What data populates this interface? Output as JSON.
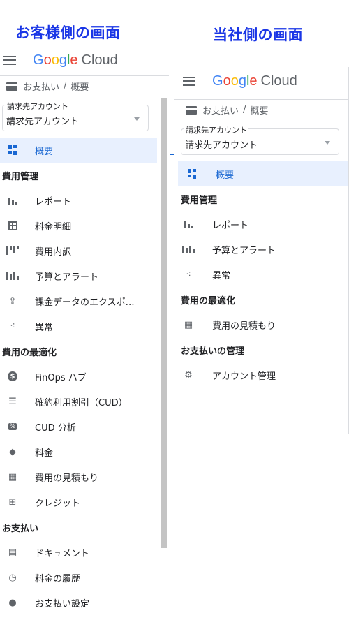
{
  "captions": {
    "left": "お客様側の画面",
    "right": "当社側の画面"
  },
  "logo": {
    "google": "Google",
    "cloud": "Cloud"
  },
  "breadcrumb": {
    "billing": "お支払い",
    "sep": "/",
    "overview": "概要"
  },
  "account": {
    "label": "請求先アカウント",
    "value": "請求先アカウント"
  },
  "left_nav": {
    "overview": "概要",
    "sec_cost_mgmt": "費用管理",
    "reports": "レポート",
    "pricing_table": "料金明細",
    "cost_breakdown": "費用内訳",
    "budgets": "予算とアラート",
    "export": "課金データのエクスポ…",
    "anomalies": "異常",
    "sec_optimization": "費用の最適化",
    "finops": "FinOps ハブ",
    "cud": "確約利用割引（CUD）",
    "cud_analysis": "CUD 分析",
    "pricing": "料金",
    "estimate": "費用の見積もり",
    "credits": "クレジット",
    "sec_payments": "お支払い",
    "documents": "ドキュメント",
    "history": "料金の履歴",
    "settings": "お支払い設定"
  },
  "right_nav": {
    "overview": "概要",
    "sec_cost_mgmt": "費用管理",
    "reports": "レポート",
    "budgets": "予算とアラート",
    "anomalies": "異常",
    "sec_optimization": "費用の最適化",
    "estimate": "費用の見積もり",
    "sec_payment_mgmt": "お支払いの管理",
    "account_mgmt": "アカウント管理"
  },
  "colors": {
    "caption": "#1a36e6",
    "active_bg": "#e8f0fe",
    "active_fg": "#1967d2",
    "icon": "#5f6368"
  },
  "icons": [
    "menu-icon",
    "dashboard-icon",
    "bar-chart-icon",
    "table-icon",
    "cost-breakdown-icon",
    "budget-icon",
    "upload-icon",
    "anomaly-icon",
    "dollar-icon",
    "list-icon",
    "percent-icon",
    "tag-icon",
    "calculator-icon",
    "gift-icon",
    "document-icon",
    "history-icon",
    "person-icon",
    "gear-icon",
    "credit-card-icon"
  ]
}
